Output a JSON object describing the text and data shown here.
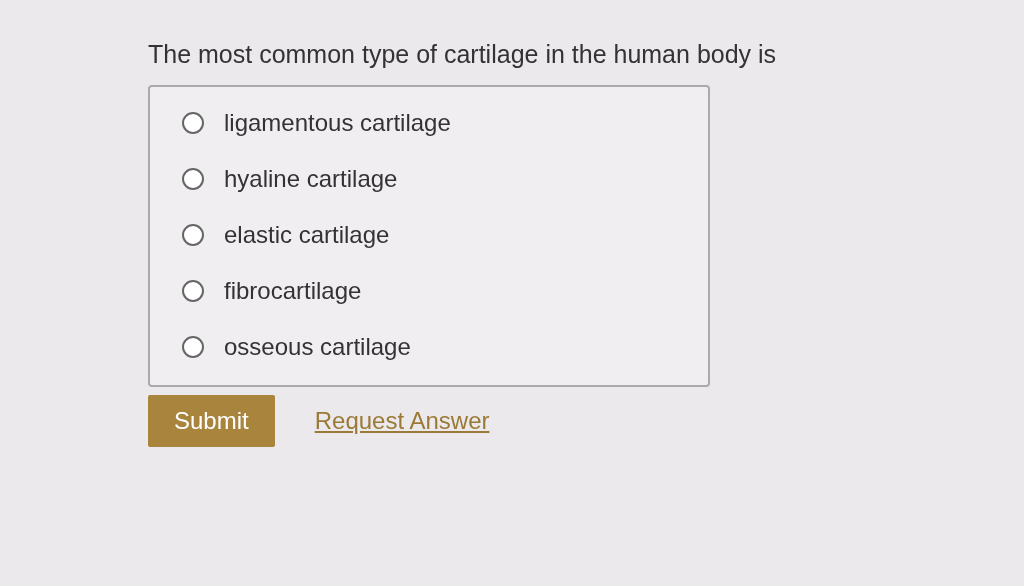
{
  "question": "The most common type of cartilage in the human body is",
  "options": [
    {
      "label": "ligamentous cartilage",
      "selected": false
    },
    {
      "label": "hyaline cartilage",
      "selected": false
    },
    {
      "label": "elastic cartilage",
      "selected": false
    },
    {
      "label": "fibrocartilage",
      "selected": false
    },
    {
      "label": "osseous cartilage",
      "selected": false
    }
  ],
  "submit": "Submit",
  "request_answer": "Request Answer"
}
